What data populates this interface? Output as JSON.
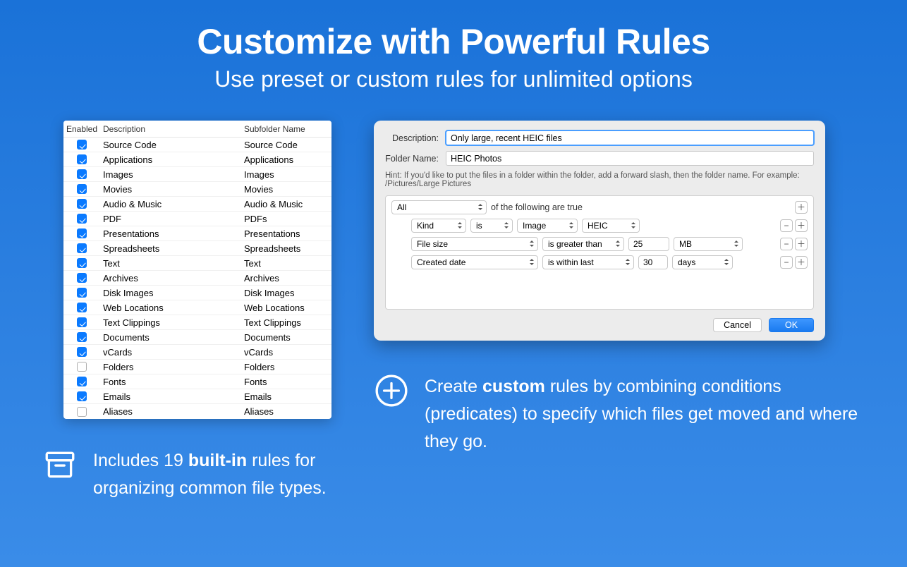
{
  "hero": {
    "title": "Customize with Powerful Rules",
    "subtitle": "Use preset or custom rules for unlimited options"
  },
  "rulesTable": {
    "columns": {
      "enabled": "Enabled",
      "description": "Description",
      "subfolder": "Subfolder Name"
    },
    "rows": [
      {
        "enabled": true,
        "description": "Source Code",
        "subfolder": "Source Code"
      },
      {
        "enabled": true,
        "description": "Applications",
        "subfolder": "Applications"
      },
      {
        "enabled": true,
        "description": "Images",
        "subfolder": "Images"
      },
      {
        "enabled": true,
        "description": "Movies",
        "subfolder": "Movies"
      },
      {
        "enabled": true,
        "description": "Audio & Music",
        "subfolder": "Audio & Music"
      },
      {
        "enabled": true,
        "description": "PDF",
        "subfolder": "PDFs"
      },
      {
        "enabled": true,
        "description": "Presentations",
        "subfolder": "Presentations"
      },
      {
        "enabled": true,
        "description": "Spreadsheets",
        "subfolder": "Spreadsheets"
      },
      {
        "enabled": true,
        "description": "Text",
        "subfolder": "Text"
      },
      {
        "enabled": true,
        "description": "Archives",
        "subfolder": "Archives"
      },
      {
        "enabled": true,
        "description": "Disk Images",
        "subfolder": "Disk Images"
      },
      {
        "enabled": true,
        "description": "Web Locations",
        "subfolder": "Web Locations"
      },
      {
        "enabled": true,
        "description": "Text Clippings",
        "subfolder": "Text Clippings"
      },
      {
        "enabled": true,
        "description": "Documents",
        "subfolder": "Documents"
      },
      {
        "enabled": true,
        "description": "vCards",
        "subfolder": "vCards"
      },
      {
        "enabled": false,
        "description": "Folders",
        "subfolder": "Folders"
      },
      {
        "enabled": true,
        "description": "Fonts",
        "subfolder": "Fonts"
      },
      {
        "enabled": true,
        "description": "Emails",
        "subfolder": "Emails"
      },
      {
        "enabled": false,
        "description": "Aliases",
        "subfolder": "Aliases"
      }
    ]
  },
  "dialog": {
    "descriptionLabel": "Description:",
    "descriptionValue": "Only large, recent HEIC files",
    "folderLabel": "Folder Name:",
    "folderValue": "HEIC Photos",
    "hint": "Hint: If you'd like to put the files in a folder within the folder, add a forward slash, then the folder name. For example: /Pictures/Large Pictures",
    "group": {
      "quantifier": "All",
      "suffix": "of the following are true"
    },
    "conditions": [
      {
        "field": "Kind",
        "op": "is",
        "value": "Image",
        "extra": "HEIC"
      },
      {
        "field": "File size",
        "op": "is greater than",
        "value": "25",
        "unit": "MB"
      },
      {
        "field": "Created date",
        "op": "is within last",
        "value": "30",
        "unit": "days"
      }
    ],
    "buttons": {
      "cancel": "Cancel",
      "ok": "OK"
    }
  },
  "captions": {
    "left_pre": "Includes 19 ",
    "left_strong": "built-in",
    "left_post": " rules for organizing common file types.",
    "right_pre": "Create ",
    "right_strong": "custom",
    "right_post": " rules by combining conditions (predicates) to specify which files get moved and where they go."
  }
}
